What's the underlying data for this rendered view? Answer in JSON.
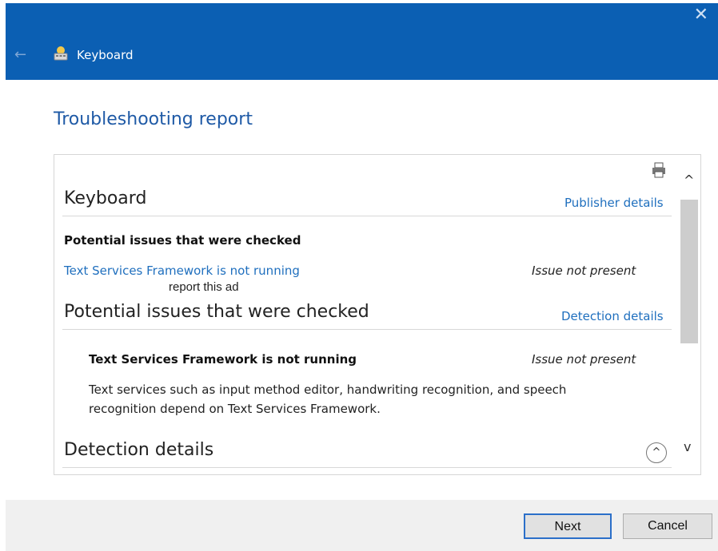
{
  "window": {
    "title": "Keyboard",
    "close_glyph": "✕",
    "back_glyph": "←"
  },
  "page": {
    "title": "Troubleshooting report"
  },
  "report": {
    "heading": "Keyboard",
    "publisher_link": "Publisher details",
    "checked_label": "Potential issues that were checked",
    "issue_link": "Text Services Framework is not running",
    "issue_status": "Issue not present",
    "ad_text": "report this ad",
    "section_heading": "Potential issues that were checked",
    "detection_link": "Detection details",
    "issue_title": "Text Services Framework is not running",
    "issue_status_2": "Issue not present",
    "issue_description": "Text services such as input method editor, handwriting recognition, and speech recognition depend on Text Services Framework.",
    "detection_heading": "Detection details",
    "collapse_glyph": "^"
  },
  "scrollbar": {
    "up_glyph": "^",
    "down_glyph": "v"
  },
  "footer": {
    "next_label": "Next",
    "cancel_label": "Cancel"
  },
  "colors": {
    "titlebar": "#0b5fb3",
    "link": "#1f6fbe",
    "title_blue": "#1f5aa6"
  }
}
